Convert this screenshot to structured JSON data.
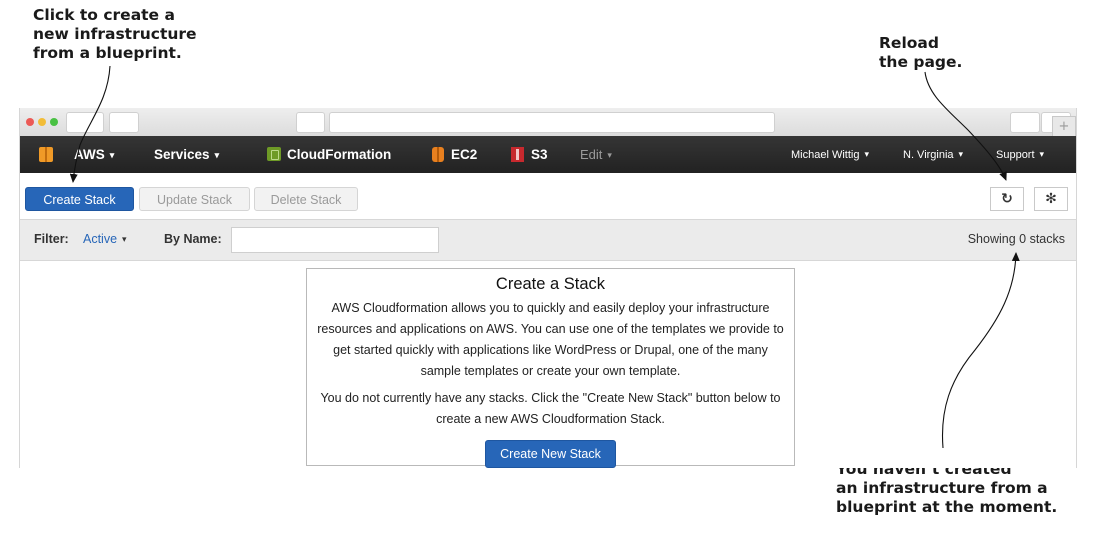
{
  "callouts": {
    "create": [
      "Click to create a",
      "new infrastructure",
      "from a blueprint."
    ],
    "reload": [
      "Reload",
      "the page."
    ],
    "empty": [
      "You haven’t created",
      "an infrastructure from a",
      "blueprint at the moment."
    ]
  },
  "navbar": {
    "aws": "AWS",
    "services": "Services",
    "cloudformation": "CloudFormation",
    "ec2": "EC2",
    "s3": "S3",
    "edit": "Edit",
    "user": "Michael Wittig",
    "region": "N. Virginia",
    "support": "Support",
    "caret": "▾"
  },
  "toolbar": {
    "create_stack": "Create Stack",
    "update_stack": "Update Stack",
    "delete_stack": "Delete Stack",
    "refresh_glyph": "↻",
    "settings_glyph": "✻"
  },
  "filter": {
    "label": "Filter:",
    "active": "Active",
    "caret": "▾",
    "by_name_label": "By Name:",
    "by_name_value": "",
    "count": "Showing 0 stacks"
  },
  "panel": {
    "title": "Create a Stack",
    "description": "AWS Cloudformation allows you to quickly and easily deploy your infrastructure resources and applications on AWS. You can use one of the templates we provide to get started quickly with applications like WordPress or Drupal, one of the many sample templates or create your own template.",
    "empty_message": "You do not currently have any stacks. Click the \"Create New Stack\" button below to create a new AWS Cloudformation Stack.",
    "button": "Create New Stack"
  },
  "icons": [
    "aws-cube-icon",
    "cloudformation-icon",
    "ec2-icon",
    "s3-icon",
    "refresh-icon",
    "settings-gear-icon"
  ]
}
